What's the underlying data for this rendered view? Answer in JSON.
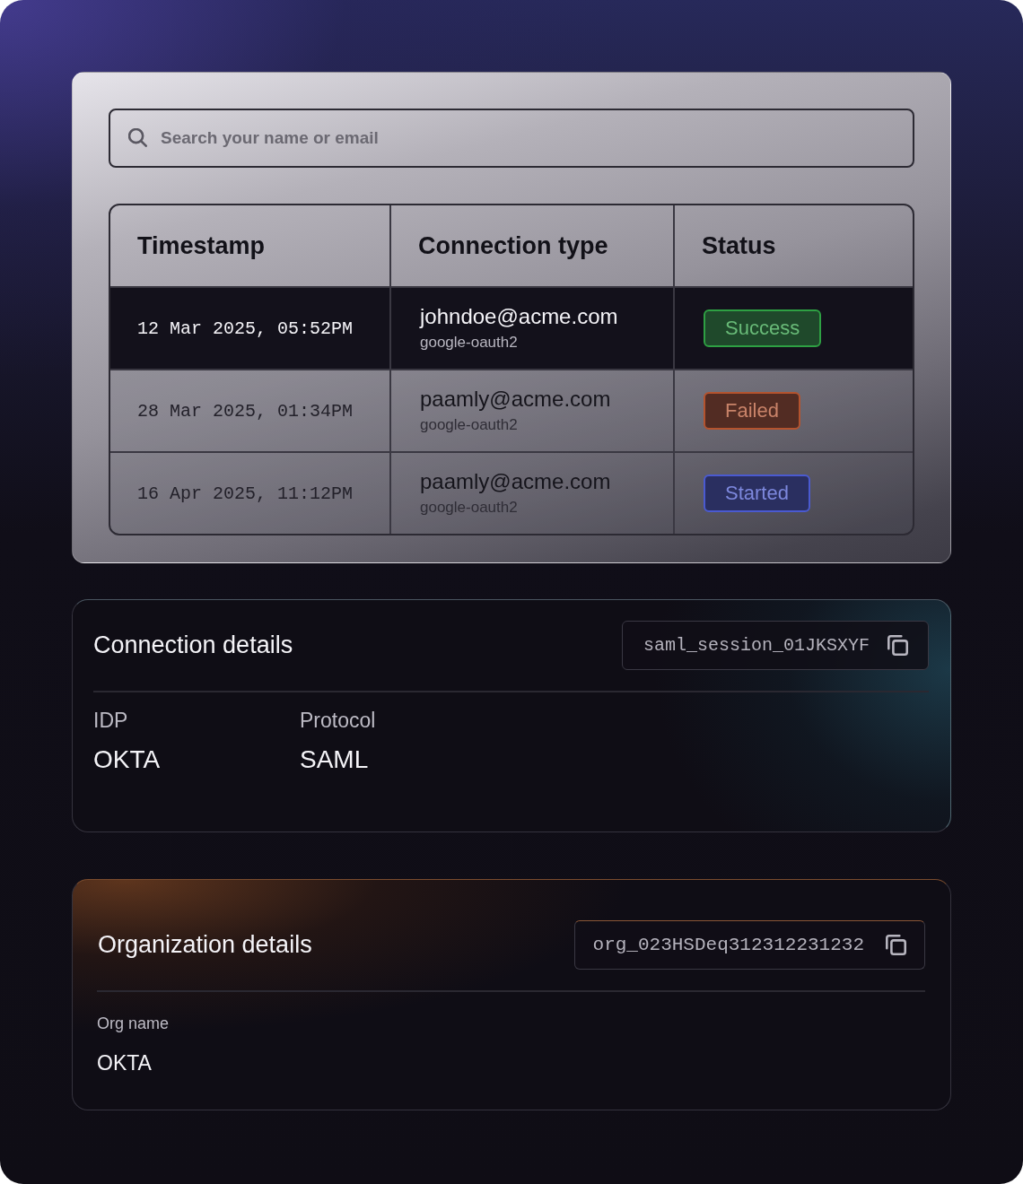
{
  "search": {
    "placeholder": "Search your name or email"
  },
  "table": {
    "columns": [
      "Timestamp",
      "Connection type",
      "Status"
    ],
    "rows": [
      {
        "selected": true,
        "timestamp": "12 Mar 2025, 05:52PM",
        "email": "johndoe@acme.com",
        "provider": "google-oauth2",
        "status": {
          "label": "Success",
          "color": "#2ea043"
        }
      },
      {
        "selected": false,
        "timestamp": "28 Mar 2025, 01:34PM",
        "email": "paamly@acme.com",
        "provider": "google-oauth2",
        "status": {
          "label": "Failed",
          "color": "#b4532e"
        }
      },
      {
        "selected": false,
        "timestamp": "16 Apr 2025, 11:12PM",
        "email": "paamly@acme.com",
        "provider": "google-oauth2",
        "status": {
          "label": "Started",
          "color": "#4a5ad0"
        }
      }
    ]
  },
  "connection_details": {
    "title": "Connection details",
    "id": "saml_session_01JKSXYF",
    "fields": [
      {
        "label": "IDP",
        "value": "OKTA"
      },
      {
        "label": "Protocol",
        "value": "SAML"
      }
    ]
  },
  "organization_details": {
    "title": "Organization details",
    "id": "org_023HSDeq312312231232",
    "fields": [
      {
        "label": "Org name",
        "value": "OKTA"
      }
    ]
  }
}
